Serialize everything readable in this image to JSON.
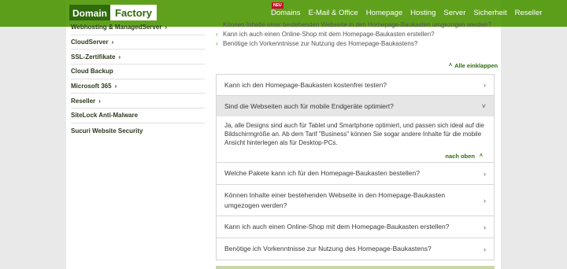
{
  "header": {
    "logo_part1": "Domain",
    "logo_part2": "Factory",
    "new_badge": "NEU",
    "nav": [
      "Domains",
      "E-Mail & Office",
      "Homepage",
      "Hosting",
      "Server",
      "Sicherheit",
      "Reseller"
    ],
    "colors": {
      "brand_green": "#5fa11d",
      "dark_green": "#2f6b0c"
    }
  },
  "sidebar": {
    "items": [
      {
        "label": "Webhosting & ManagedServer",
        "has_chevron": true
      },
      {
        "label": "CloudServer",
        "has_chevron": true
      },
      {
        "label": "SSL-Zertifikate",
        "has_chevron": true
      },
      {
        "label": "Cloud Backup",
        "has_chevron": false
      },
      {
        "label": "Microsoft 365",
        "has_chevron": true
      },
      {
        "label": "Reseller",
        "has_chevron": true
      },
      {
        "label": "SiteLock Anti-Malware",
        "has_chevron": false
      },
      {
        "label": "Sucuri Website Security",
        "has_chevron": false
      }
    ]
  },
  "toplinks": [
    "Können Inhalte einer bestehenden Webseite in den Homepage-Baukasten umgezogen werden?",
    "Kann ich auch einen Online-Shop mit dem Homepage-Baukasten erstellen?",
    "Benötige ich Vorkenntnisse zur Nutzung des Homepage-Baukastens?"
  ],
  "collapse_all": "Alle einklappen",
  "faq": [
    {
      "question": "Kann ich den Homepage-Baukasten kostenfrei testen?",
      "open": false
    },
    {
      "question": "Sind die Webseiten auch für mobile Endgeräte optimiert?",
      "open": true,
      "answer": "Ja, alle Designs sind auch für Tablet und Smartphone optimiert, und passen sich ideal auf die Bildschirmgröße an. Ab dem Tarif \"Business\" können Sie sogar andere Inhalte für die mobile Ansicht hinterlegen als für Desktop-PCs.",
      "back_to_top": "nach oben"
    },
    {
      "question": "Welche Pakete kann ich für den Homepage-Baukasten bestellen?",
      "open": false
    },
    {
      "question": "Können Inhalte einer bestehenden Webseite in den Homepage-Baukasten umgezogen werden?",
      "open": false
    },
    {
      "question": "Kann ich auch einen Online-Shop mit dem Homepage-Baukasten erstellen?",
      "open": false
    },
    {
      "question": "Benötige ich Vorkenntnisse zur Nutzung des Homepage-Baukastens?",
      "open": false
    }
  ]
}
